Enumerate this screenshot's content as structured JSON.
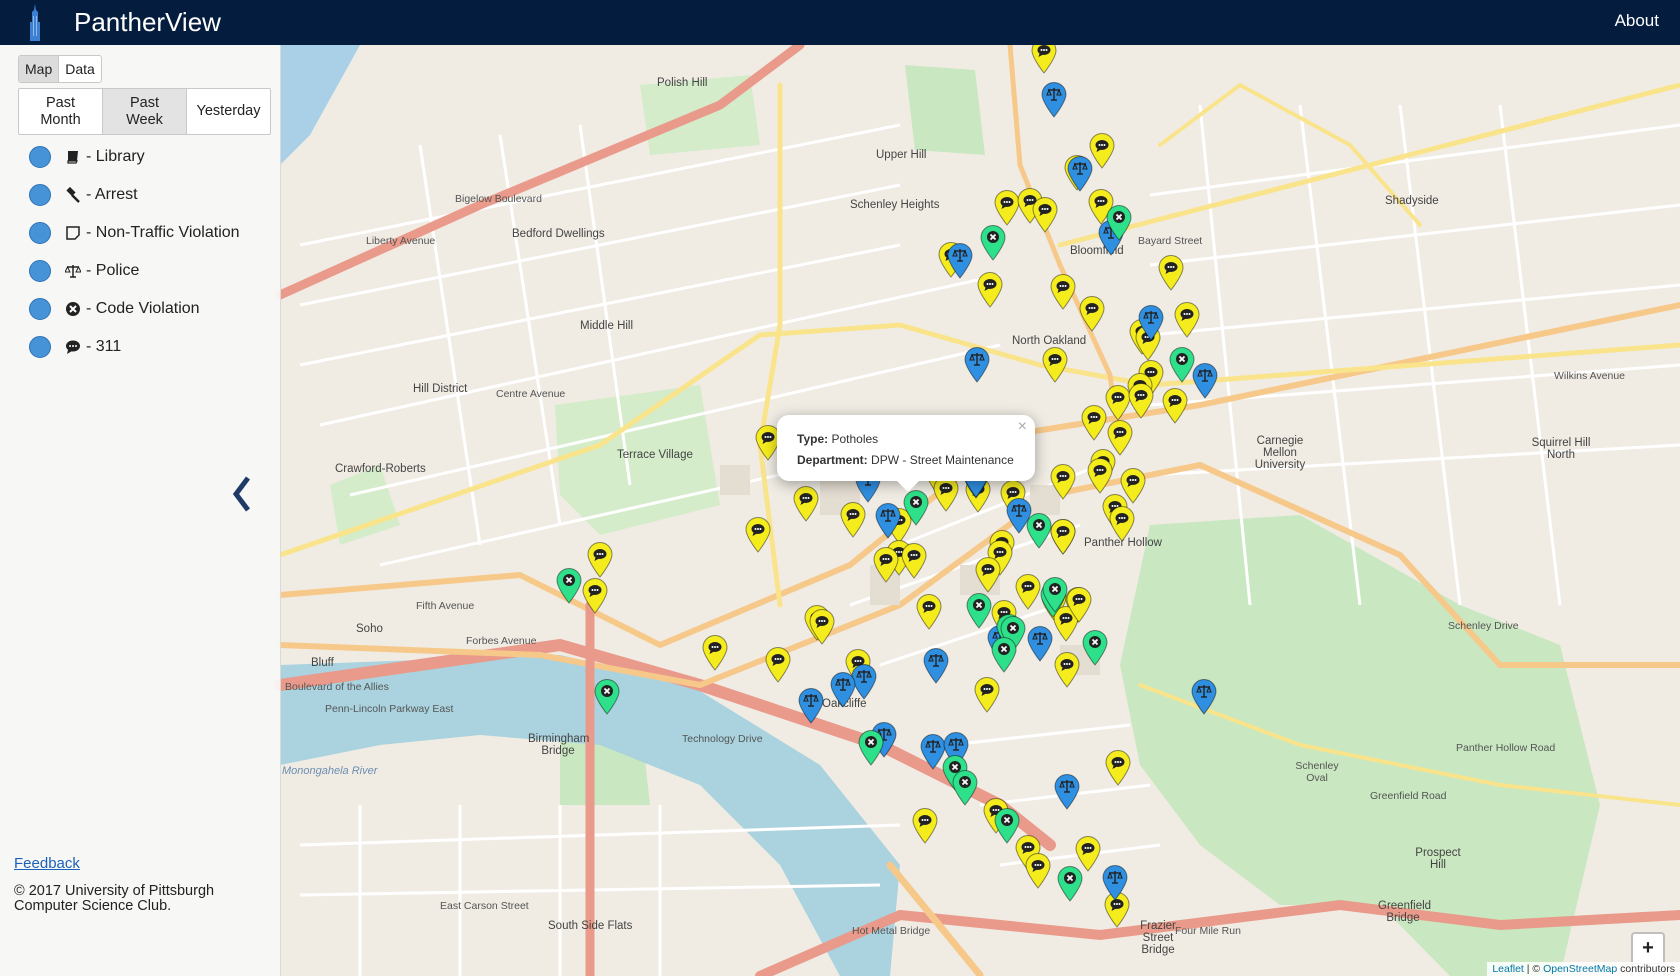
{
  "app": {
    "name": "PantherView",
    "about": "About"
  },
  "sidebar": {
    "tabs": [
      "Map",
      "Data"
    ],
    "range": [
      "Past\nMonth",
      "Past\nWeek",
      "Yesterday"
    ],
    "legend": [
      {
        "icon": "book-icon",
        "label": "- Library"
      },
      {
        "icon": "gavel-icon",
        "label": "- Arrest"
      },
      {
        "icon": "sticky-note-icon",
        "label": "- Non-Traffic Violation"
      },
      {
        "icon": "balance-scale-icon",
        "label": "- Police"
      },
      {
        "icon": "x-circle-icon",
        "label": "- Code Violation"
      },
      {
        "icon": "comment-icon",
        "label": "- 311"
      }
    ],
    "feedback": "Feedback",
    "copyright": "© 2017 University of Pittsburgh Computer Science Club."
  },
  "popup": {
    "type_label": "Type:",
    "type_value": "Potholes",
    "dept_label": "Department:",
    "dept_value": "DPW - Street Maintenance"
  },
  "map": {
    "zoom_in": "+",
    "zoom_out": "−",
    "attribution_leaflet": "Leaflet",
    "attribution_sep": " | © ",
    "attribution_osm": "OpenStreetMap",
    "attribution_rest": " contributors",
    "colors": {
      "311": "#f5ec1e",
      "police": "#2f8fe0",
      "code": "#2ee08a"
    },
    "labels": [
      "Polish Hill",
      "Upper Hill",
      "Schenley Heights",
      "Bedford Dwellings",
      "Middle Hill",
      "Hill District",
      "Crawford-Roberts",
      "Terrace Village",
      "North Oakland",
      "Carnegie Mellon University",
      "Oakcliffe",
      "Birmingham Bridge",
      "Panther Hollow",
      "Bluff",
      "Soho",
      "South Side Flats",
      "Squirrel Hill North",
      "Shadyside",
      "Bloomfield",
      "Frazier Street Bridge",
      "Greenfield Bridge",
      "Prospect Hill",
      "Schenley Oval",
      "Monongahela River",
      "Fifth Avenue",
      "Forbes Avenue",
      "Centre Avenue",
      "Bigelow Boulevard",
      "Penn-Lincoln Parkway East",
      "East Carson Street",
      "Panther Hollow Road",
      "Schenley Drive",
      "Greenfield Road",
      "Boulevard of the Allies",
      "Bayard Street",
      "Wilkins Avenue",
      "Hot Metal Bridge",
      "Four Mile Run",
      "Technology Drive",
      "Liberty Avenue"
    ]
  }
}
